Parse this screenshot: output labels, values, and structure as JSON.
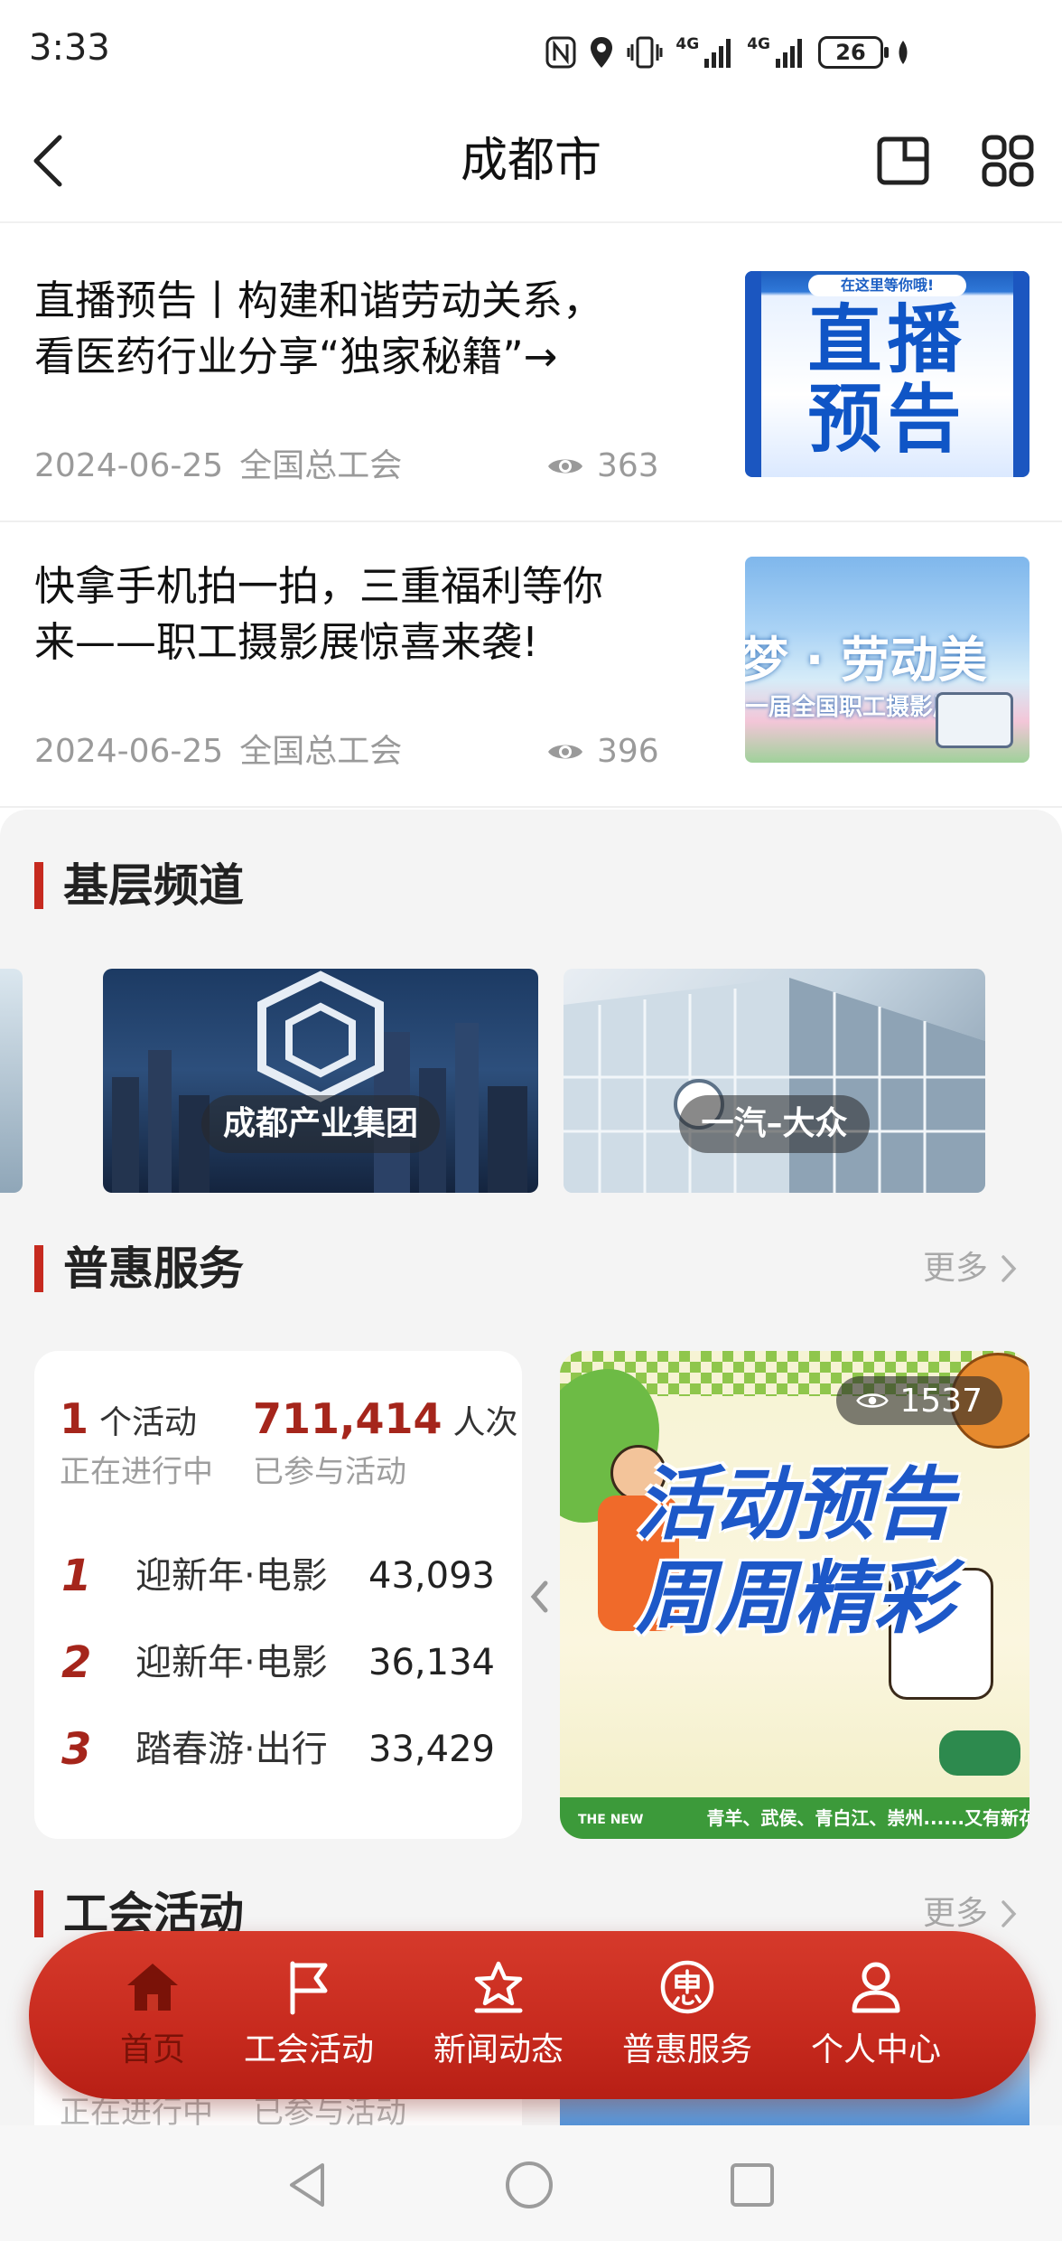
{
  "status_bar": {
    "time": "3:33",
    "network_1": "4G",
    "network_2": "4G",
    "battery": "26",
    "icons": [
      "nfc-icon",
      "location-icon",
      "vibrate-icon",
      "signal-icon",
      "signal-icon",
      "battery-icon"
    ]
  },
  "header": {
    "title": "成都市",
    "left_icon": "back-arrow-icon",
    "right_icons": [
      "mini-window-icon",
      "grid-apps-icon"
    ]
  },
  "news": [
    {
      "title_lines": [
        "直播预告丨构建和谐劳动关系，",
        "看医药行业分享“独家秘籍”→"
      ],
      "date": "2024-06-25",
      "source": "全国总工会",
      "views": "363",
      "thumb": {
        "tag": "在这里等你哦!",
        "line1": "直播",
        "line2": "预告"
      }
    },
    {
      "title_lines": [
        "快拿手机拍一拍，三重福利等你",
        "来——职工摄影展惊喜来袭!"
      ],
      "date": "2024-06-25",
      "source": "全国总工会",
      "views": "396",
      "thumb": {
        "line1": "梦 · 劳动美",
        "line2": "一届全国职工摄影展"
      }
    }
  ],
  "channels": {
    "title": "基层频道",
    "items": [
      {
        "label": "成都产业集团"
      },
      {
        "label": "一汽–大众"
      }
    ]
  },
  "benefits": {
    "title": "普惠服务",
    "more": "更多",
    "stats": {
      "active_count": "1",
      "active_unit": "个活动",
      "active_sub": "正在进行中",
      "participants": "711,414",
      "participants_unit": "人次",
      "participants_sub": "已参与活动"
    },
    "ranking": [
      {
        "rank": "1",
        "name": "迎新年·电影",
        "value": "43,093"
      },
      {
        "rank": "2",
        "name": "迎新年·电影",
        "value": "36,134"
      },
      {
        "rank": "3",
        "name": "踏春游·出行",
        "value": "33,429"
      }
    ],
    "banner": {
      "views": "1537",
      "headline_1": "活动预告",
      "headline_2": "周周精彩",
      "footer_badge": "THE NEW",
      "footer_text": "青羊、武侯、青白江、崇州......又有新花样"
    }
  },
  "activities": {
    "title": "工会活动",
    "more": "更多",
    "preview_sub_1": "正在进行中",
    "preview_sub_2": "已参与活动"
  },
  "bottom_nav": [
    {
      "label": "首页",
      "icon": "home-icon",
      "active": true
    },
    {
      "label": "工会活动",
      "icon": "flag-icon",
      "active": false
    },
    {
      "label": "新闻动态",
      "icon": "star-badge-icon",
      "active": false
    },
    {
      "label": "普惠服务",
      "icon": "hui-coupon-icon",
      "active": false
    },
    {
      "label": "个人中心",
      "icon": "person-icon",
      "active": false
    }
  ],
  "colors": {
    "accent": "#c62a1f",
    "nav_background": "#c72a1e",
    "stat_number": "#a5251b",
    "page_gray": "#f4f4f4"
  }
}
